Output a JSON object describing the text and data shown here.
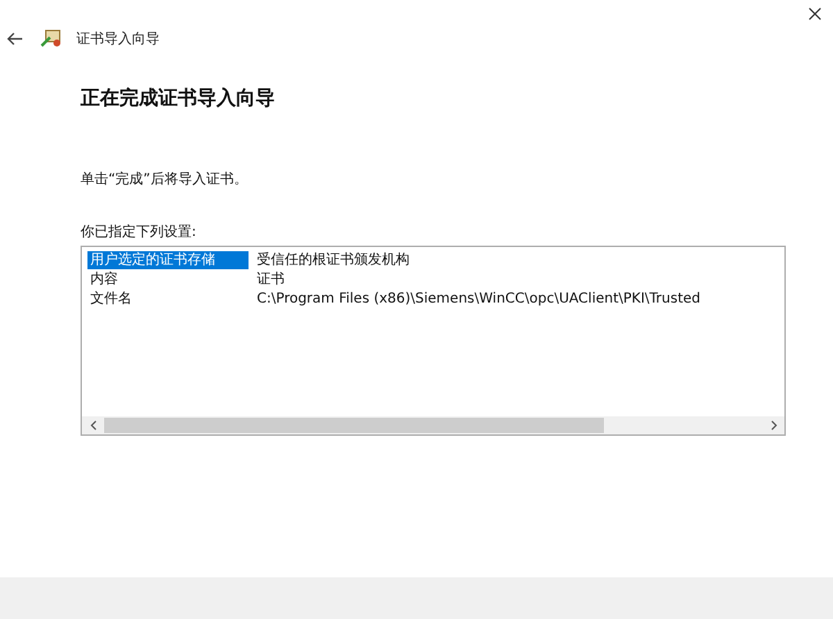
{
  "window": {
    "title": "证书导入向导"
  },
  "heading": "正在完成证书导入向导",
  "instruction": "单击“完成”后将导入证书。",
  "settings_label": "你已指定下列设置:",
  "settings": [
    {
      "name": "用户选定的证书存储",
      "value": "受信任的根证书颁发机构",
      "selected": true
    },
    {
      "name": "内容",
      "value": "证书",
      "selected": false
    },
    {
      "name": "文件名",
      "value": "C:\\Program Files (x86)\\Siemens\\WinCC\\opc\\UAClient\\PKI\\Trusted",
      "selected": false
    }
  ]
}
